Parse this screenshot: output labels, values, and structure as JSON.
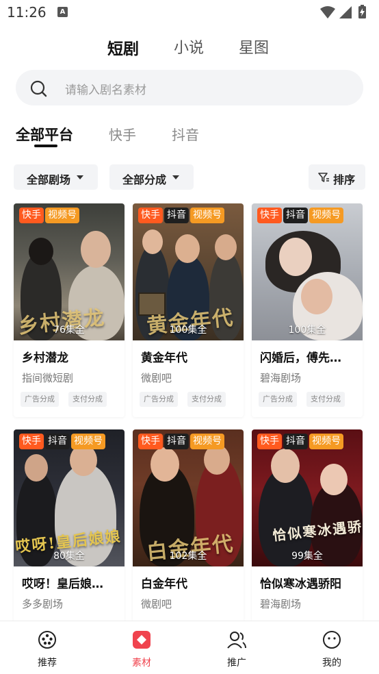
{
  "status_bar": {
    "time": "11:26",
    "notification_letter": "A"
  },
  "top_tabs": [
    {
      "label": "短剧",
      "active": true
    },
    {
      "label": "小说",
      "active": false
    },
    {
      "label": "星图",
      "active": false
    }
  ],
  "search": {
    "placeholder": "请输入剧名素材"
  },
  "platform_tabs": [
    {
      "label": "全部平台",
      "active": true
    },
    {
      "label": "快手",
      "active": false
    },
    {
      "label": "抖音",
      "active": false
    }
  ],
  "filters": {
    "theater": "全部剧场",
    "split": "全部分成",
    "sort": "排序"
  },
  "cards": [
    {
      "title": "乡村潜龙",
      "studio": "指间微短剧",
      "episodes": "76集全",
      "tags": [
        "快手",
        "视频号"
      ],
      "chips": [
        "广告分成",
        "支付分成"
      ],
      "art": "乡村潜龙"
    },
    {
      "title": "黄金年代",
      "studio": "微剧吧",
      "episodes": "100集全",
      "tags": [
        "快手",
        "抖音",
        "视频号"
      ],
      "chips": [
        "广告分成",
        "支付分成"
      ],
      "art": "黄金年代"
    },
    {
      "title": "闪婚后，傅先…",
      "studio": "碧海剧场",
      "episodes": "100集全",
      "tags": [
        "快手",
        "抖音",
        "视频号"
      ],
      "chips": [
        "广告分成",
        "支付分成"
      ],
      "art": ""
    },
    {
      "title": "哎呀！皇后娘…",
      "studio": "多多剧场",
      "episodes": "80集全",
      "tags": [
        "快手",
        "抖音",
        "视频号"
      ],
      "chips": [],
      "art": "哎呀!皇后娘娘"
    },
    {
      "title": "白金年代",
      "studio": "微剧吧",
      "episodes": "102集全",
      "tags": [
        "快手",
        "抖音",
        "视频号"
      ],
      "chips": [],
      "art": "白金年代"
    },
    {
      "title": "恰似寒冰遇骄阳",
      "studio": "碧海剧场",
      "episodes": "99集全",
      "tags": [
        "快手",
        "抖音",
        "视频号"
      ],
      "chips": [],
      "art": "恰似寒冰遇骄阳"
    }
  ],
  "bottom_nav": [
    {
      "label": "推荐",
      "icon": "film-reel-icon",
      "active": false
    },
    {
      "label": "素材",
      "icon": "material-icon",
      "active": true
    },
    {
      "label": "推广",
      "icon": "users-icon",
      "active": false
    },
    {
      "label": "我的",
      "icon": "smile-face-icon",
      "active": false
    }
  ],
  "colors": {
    "kuaishou_tag": "#ff5a1f",
    "douyin_tag": "#1f1f1f",
    "shipinhao_tag": "#f59a23",
    "accent": "#f0434e"
  }
}
